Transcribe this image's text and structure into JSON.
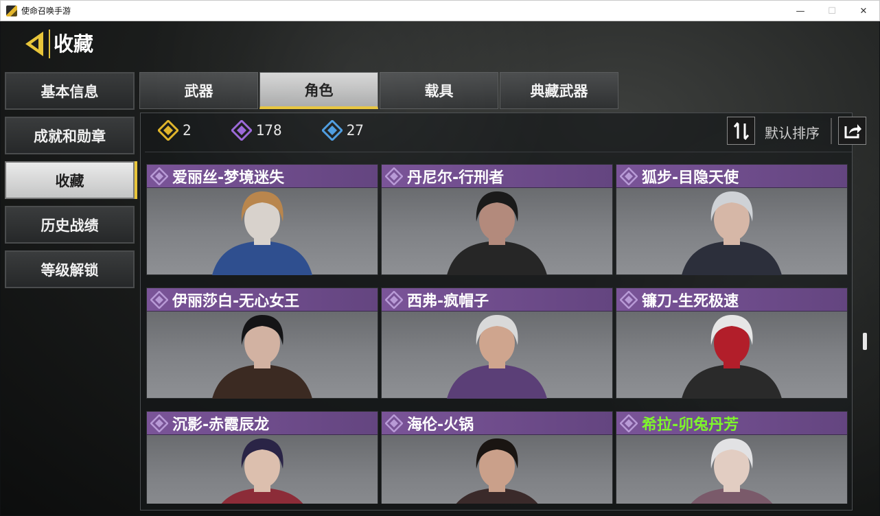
{
  "window": {
    "title": "使命召唤手游",
    "minimize": "—",
    "maximize": "☐",
    "close": "✕"
  },
  "header": {
    "title": "收藏"
  },
  "sidebar": {
    "items": [
      {
        "label": "基本信息"
      },
      {
        "label": "成就和勋章"
      },
      {
        "label": "收藏",
        "active": true
      },
      {
        "label": "历史战绩"
      },
      {
        "label": "等级解锁"
      }
    ]
  },
  "tabs": [
    {
      "label": "武器"
    },
    {
      "label": "角色",
      "active": true
    },
    {
      "label": "载具"
    },
    {
      "label": "典藏武器"
    }
  ],
  "stats": [
    {
      "icon": "gold-diamond-icon",
      "value": "2",
      "color": "#e0b52a"
    },
    {
      "icon": "purple-diamond-icon",
      "value": "178",
      "color": "#9a67d8"
    },
    {
      "icon": "blue-diamond-icon",
      "value": "27",
      "color": "#4a9be0"
    }
  ],
  "sort": {
    "label": "默认排序"
  },
  "cards": [
    {
      "name": "爱丽丝-梦境迷失",
      "hair": "#b9864d",
      "cloth": "#2f4f8f",
      "skin": "#d8d2cc"
    },
    {
      "name": "丹尼尔-行刑者",
      "hair": "#1a1a1a",
      "cloth": "#262626",
      "skin": "#b38a7c"
    },
    {
      "name": "狐步-目隐天使",
      "hair": "#cfd2d6",
      "cloth": "#2c2f3b",
      "skin": "#d6b7a7"
    },
    {
      "name": "伊丽莎白-无心女王",
      "hair": "#141416",
      "cloth": "#3b2a22",
      "skin": "#d2b2a2"
    },
    {
      "name": "西弗-疯帽子",
      "hair": "#d9d9d9",
      "cloth": "#5b3f77",
      "skin": "#cfa58e"
    },
    {
      "name": "镰刀-生死极速",
      "hair": "#e6e6e6",
      "cloth": "#2a2a2a",
      "skin": "#b21e2a"
    },
    {
      "name": "沉影-赤霞辰龙",
      "hair": "#2a2446",
      "cloth": "#8c2c38",
      "skin": "#dcbfae"
    },
    {
      "name": "海伦-火锅",
      "hair": "#1a1512",
      "cloth": "#3a2a2a",
      "skin": "#caa08a"
    },
    {
      "name": "希拉-卯兔丹芳",
      "hair": "#e2e2e4",
      "cloth": "#7a5a6a",
      "skin": "#e2cdc2",
      "highlight": true
    }
  ],
  "colors": {
    "accent": "#e8c53a",
    "card_header": "#6f4c8c",
    "highlight_name": "#7ef52b"
  }
}
